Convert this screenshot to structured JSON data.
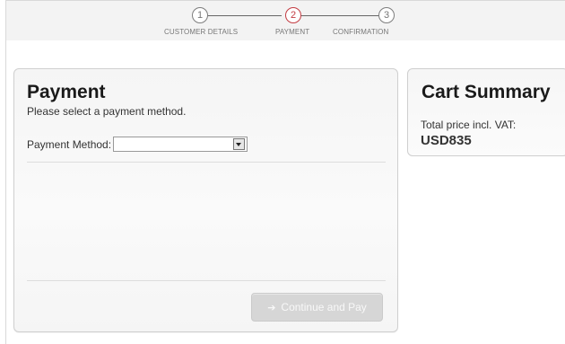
{
  "checkout_steps": [
    {
      "number": "1",
      "label": "CUSTOMER DETAILS",
      "state": "completed"
    },
    {
      "number": "2",
      "label": "PAYMENT",
      "state": "active"
    },
    {
      "number": "3",
      "label": "CONFIRMATION",
      "state": "upcoming"
    }
  ],
  "payment": {
    "title": "Payment",
    "subtitle": "Please select a payment method.",
    "method_label": "Payment Method:",
    "method_value": "",
    "continue_label": "Continue and Pay"
  },
  "cart_summary": {
    "title": "Cart Summary",
    "total_label": "Total price incl. VAT:",
    "total_value": "USD835"
  },
  "colors": {
    "active_step": "#c33b42",
    "inactive_step": "#7d7d7d",
    "panel_border": "#cfcfcf",
    "button_disabled": "#d6d6d6"
  },
  "icons": {
    "continue_arrow": "right-arrow-icon",
    "dropdown": "chevron-down-icon"
  }
}
